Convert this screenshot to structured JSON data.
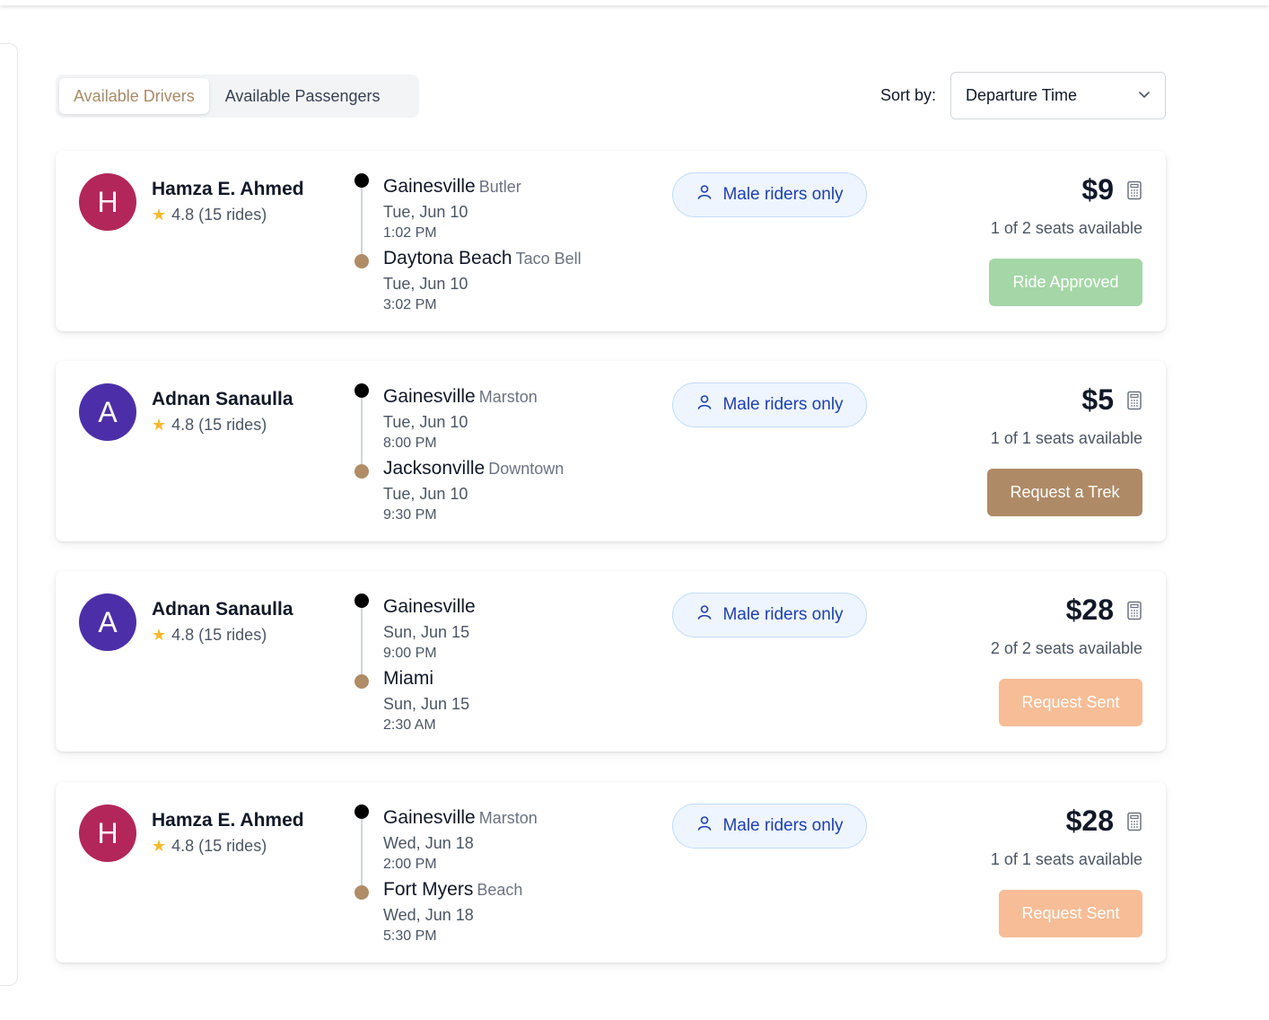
{
  "tabs": [
    {
      "label": "Available Drivers",
      "active": true
    },
    {
      "label": "Available Passengers",
      "active": false
    }
  ],
  "sort": {
    "label": "Sort by:",
    "value": "Departure Time"
  },
  "rides": [
    {
      "avatar_letter": "H",
      "avatar_color": "#b3265a",
      "driver": "Hamza E. Ahmed",
      "rating": "4.8 (15 rides)",
      "from": {
        "city": "Gainesville",
        "area": "Butler",
        "date": "Tue, Jun 10",
        "time": "1:02 PM"
      },
      "to": {
        "city": "Daytona Beach",
        "area": "Taco Bell",
        "date": "Tue, Jun 10",
        "time": "3:02 PM"
      },
      "badge": "Male riders only",
      "price": "$9",
      "seats": "1 of 2 seats available",
      "action": "Ride Approved",
      "action_style": "approved"
    },
    {
      "avatar_letter": "A",
      "avatar_color": "#4c2fa8",
      "driver": "Adnan Sanaulla",
      "rating": "4.8 (15 rides)",
      "from": {
        "city": "Gainesville",
        "area": "Marston",
        "date": "Tue, Jun 10",
        "time": "8:00 PM"
      },
      "to": {
        "city": "Jacksonville",
        "area": "Downtown",
        "date": "Tue, Jun 10",
        "time": "9:30 PM"
      },
      "badge": "Male riders only",
      "price": "$5",
      "seats": "1 of 1 seats available",
      "action": "Request a Trek",
      "action_style": "request"
    },
    {
      "avatar_letter": "A",
      "avatar_color": "#4c2fa8",
      "driver": "Adnan Sanaulla",
      "rating": "4.8 (15 rides)",
      "from": {
        "city": "Gainesville",
        "area": "",
        "date": "Sun, Jun 15",
        "time": "9:00 PM"
      },
      "to": {
        "city": "Miami",
        "area": "",
        "date": "Sun, Jun 15",
        "time": "2:30 AM"
      },
      "badge": "Male riders only",
      "price": "$28",
      "seats": "2 of 2 seats available",
      "action": "Request Sent",
      "action_style": "sent"
    },
    {
      "avatar_letter": "H",
      "avatar_color": "#b3265a",
      "driver": "Hamza E. Ahmed",
      "rating": "4.8 (15 rides)",
      "from": {
        "city": "Gainesville",
        "area": "Marston",
        "date": "Wed, Jun 18",
        "time": "2:00 PM"
      },
      "to": {
        "city": "Fort Myers",
        "area": "Beach",
        "date": "Wed, Jun 18",
        "time": "5:30 PM"
      },
      "badge": "Male riders only",
      "price": "$28",
      "seats": "1 of 1 seats available",
      "action": "Request Sent",
      "action_style": "sent"
    }
  ]
}
